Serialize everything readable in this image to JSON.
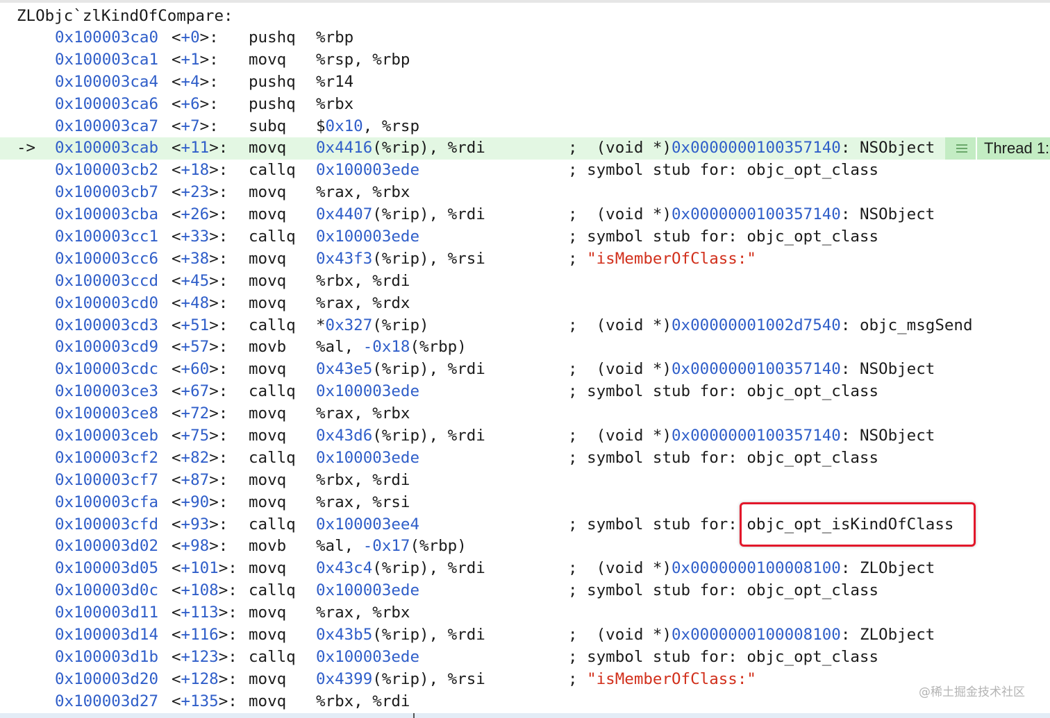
{
  "function_header": "ZLObjc`zlKindOfCompare:",
  "colors": {
    "address": "#2f5ec9",
    "string": "#d12f1b",
    "current_line_bg": "#e3f7e3",
    "thread_badge_bg": "#c3ecc3",
    "highlight_border": "#e2172a"
  },
  "current_line_indicator": "->",
  "thread_badge": {
    "icon": "lines-icon",
    "label": "Thread 1:"
  },
  "highlighted_text": "objc_opt_isKindOfClass",
  "watermark": "@稀土掘金技术社区",
  "instructions": [
    {
      "addr": "0x100003ca0",
      "off_pre": "<",
      "off": "+0",
      "off_post": ">:",
      "mnemonic": "pushq",
      "ops": [
        {
          "t": "%rbp",
          "c": ""
        }
      ],
      "comment": []
    },
    {
      "addr": "0x100003ca1",
      "off_pre": "<",
      "off": "+1",
      "off_post": ">:",
      "mnemonic": "movq",
      "ops": [
        {
          "t": "%rsp, %rbp",
          "c": ""
        }
      ],
      "comment": []
    },
    {
      "addr": "0x100003ca4",
      "off_pre": "<",
      "off": "+4",
      "off_post": ">:",
      "mnemonic": "pushq",
      "ops": [
        {
          "t": "%r14",
          "c": ""
        }
      ],
      "comment": []
    },
    {
      "addr": "0x100003ca6",
      "off_pre": "<",
      "off": "+6",
      "off_post": ">:",
      "mnemonic": "pushq",
      "ops": [
        {
          "t": "%rbx",
          "c": ""
        }
      ],
      "comment": []
    },
    {
      "addr": "0x100003ca7",
      "off_pre": "<",
      "off": "+7",
      "off_post": ">:",
      "mnemonic": "subq",
      "ops": [
        {
          "t": "$",
          "c": ""
        },
        {
          "t": "0x10",
          "c": "blue"
        },
        {
          "t": ", %rsp",
          "c": ""
        }
      ],
      "comment": []
    },
    {
      "current": true,
      "addr": "0x100003cab",
      "off_pre": "<",
      "off": "+11",
      "off_post": ">:",
      "mnemonic": "movq",
      "ops": [
        {
          "t": "0x4416",
          "c": "blue"
        },
        {
          "t": "(%rip), %rdi",
          "c": ""
        }
      ],
      "comment": [
        {
          "t": ";  (void *)",
          "c": ""
        },
        {
          "t": "0x0000000100357140",
          "c": "blue"
        },
        {
          "t": ": NSObject",
          "c": ""
        }
      ]
    },
    {
      "addr": "0x100003cb2",
      "off_pre": "<",
      "off": "+18",
      "off_post": ">:",
      "mnemonic": "callq",
      "ops": [
        {
          "t": "0x100003ede",
          "c": "blue"
        }
      ],
      "comment": [
        {
          "t": "; symbol stub for: objc_opt_class",
          "c": ""
        }
      ]
    },
    {
      "addr": "0x100003cb7",
      "off_pre": "<",
      "off": "+23",
      "off_post": ">:",
      "mnemonic": "movq",
      "ops": [
        {
          "t": "%rax, %rbx",
          "c": ""
        }
      ],
      "comment": []
    },
    {
      "addr": "0x100003cba",
      "off_pre": "<",
      "off": "+26",
      "off_post": ">:",
      "mnemonic": "movq",
      "ops": [
        {
          "t": "0x4407",
          "c": "blue"
        },
        {
          "t": "(%rip), %rdi",
          "c": ""
        }
      ],
      "comment": [
        {
          "t": ";  (void *)",
          "c": ""
        },
        {
          "t": "0x0000000100357140",
          "c": "blue"
        },
        {
          "t": ": NSObject",
          "c": ""
        }
      ]
    },
    {
      "addr": "0x100003cc1",
      "off_pre": "<",
      "off": "+33",
      "off_post": ">:",
      "mnemonic": "callq",
      "ops": [
        {
          "t": "0x100003ede",
          "c": "blue"
        }
      ],
      "comment": [
        {
          "t": "; symbol stub for: objc_opt_class",
          "c": ""
        }
      ]
    },
    {
      "addr": "0x100003cc6",
      "off_pre": "<",
      "off": "+38",
      "off_post": ">:",
      "mnemonic": "movq",
      "ops": [
        {
          "t": "0x43f3",
          "c": "blue"
        },
        {
          "t": "(%rip), %rsi",
          "c": ""
        }
      ],
      "comment": [
        {
          "t": "; ",
          "c": ""
        },
        {
          "t": "\"isMemberOfClass:\"",
          "c": "str"
        }
      ]
    },
    {
      "addr": "0x100003ccd",
      "off_pre": "<",
      "off": "+45",
      "off_post": ">:",
      "mnemonic": "movq",
      "ops": [
        {
          "t": "%rbx, %rdi",
          "c": ""
        }
      ],
      "comment": []
    },
    {
      "addr": "0x100003cd0",
      "off_pre": "<",
      "off": "+48",
      "off_post": ">:",
      "mnemonic": "movq",
      "ops": [
        {
          "t": "%rax, %rdx",
          "c": ""
        }
      ],
      "comment": []
    },
    {
      "addr": "0x100003cd3",
      "off_pre": "<",
      "off": "+51",
      "off_post": ">:",
      "mnemonic": "callq",
      "ops": [
        {
          "t": "*",
          "c": ""
        },
        {
          "t": "0x327",
          "c": "blue"
        },
        {
          "t": "(%rip)",
          "c": ""
        }
      ],
      "comment": [
        {
          "t": ";  (void *)",
          "c": ""
        },
        {
          "t": "0x00000001002d7540",
          "c": "blue"
        },
        {
          "t": ": objc_msgSend",
          "c": ""
        }
      ]
    },
    {
      "addr": "0x100003cd9",
      "off_pre": "<",
      "off": "+57",
      "off_post": ">:",
      "mnemonic": "movb",
      "ops": [
        {
          "t": "%al, ",
          "c": ""
        },
        {
          "t": "-0x18",
          "c": "blue"
        },
        {
          "t": "(%rbp)",
          "c": ""
        }
      ],
      "comment": []
    },
    {
      "addr": "0x100003cdc",
      "off_pre": "<",
      "off": "+60",
      "off_post": ">:",
      "mnemonic": "movq",
      "ops": [
        {
          "t": "0x43e5",
          "c": "blue"
        },
        {
          "t": "(%rip), %rdi",
          "c": ""
        }
      ],
      "comment": [
        {
          "t": ";  (void *)",
          "c": ""
        },
        {
          "t": "0x0000000100357140",
          "c": "blue"
        },
        {
          "t": ": NSObject",
          "c": ""
        }
      ]
    },
    {
      "addr": "0x100003ce3",
      "off_pre": "<",
      "off": "+67",
      "off_post": ">:",
      "mnemonic": "callq",
      "ops": [
        {
          "t": "0x100003ede",
          "c": "blue"
        }
      ],
      "comment": [
        {
          "t": "; symbol stub for: objc_opt_class",
          "c": ""
        }
      ]
    },
    {
      "addr": "0x100003ce8",
      "off_pre": "<",
      "off": "+72",
      "off_post": ">:",
      "mnemonic": "movq",
      "ops": [
        {
          "t": "%rax, %rbx",
          "c": ""
        }
      ],
      "comment": []
    },
    {
      "addr": "0x100003ceb",
      "off_pre": "<",
      "off": "+75",
      "off_post": ">:",
      "mnemonic": "movq",
      "ops": [
        {
          "t": "0x43d6",
          "c": "blue"
        },
        {
          "t": "(%rip), %rdi",
          "c": ""
        }
      ],
      "comment": [
        {
          "t": ";  (void *)",
          "c": ""
        },
        {
          "t": "0x0000000100357140",
          "c": "blue"
        },
        {
          "t": ": NSObject",
          "c": ""
        }
      ]
    },
    {
      "addr": "0x100003cf2",
      "off_pre": "<",
      "off": "+82",
      "off_post": ">:",
      "mnemonic": "callq",
      "ops": [
        {
          "t": "0x100003ede",
          "c": "blue"
        }
      ],
      "comment": [
        {
          "t": "; symbol stub for: objc_opt_class",
          "c": ""
        }
      ]
    },
    {
      "addr": "0x100003cf7",
      "off_pre": "<",
      "off": "+87",
      "off_post": ">:",
      "mnemonic": "movq",
      "ops": [
        {
          "t": "%rbx, %rdi",
          "c": ""
        }
      ],
      "comment": []
    },
    {
      "addr": "0x100003cfa",
      "off_pre": "<",
      "off": "+90",
      "off_post": ">:",
      "mnemonic": "movq",
      "ops": [
        {
          "t": "%rax, %rsi",
          "c": ""
        }
      ],
      "comment": []
    },
    {
      "addr": "0x100003cfd",
      "off_pre": "<",
      "off": "+93",
      "off_post": ">:",
      "mnemonic": "callq",
      "ops": [
        {
          "t": "0x100003ee4",
          "c": "blue"
        }
      ],
      "comment": [
        {
          "t": "; symbol stub for: ",
          "c": ""
        },
        {
          "t": "objc_opt_isKindOfClass",
          "c": ""
        }
      ]
    },
    {
      "addr": "0x100003d02",
      "off_pre": "<",
      "off": "+98",
      "off_post": ">:",
      "mnemonic": "movb",
      "ops": [
        {
          "t": "%al, ",
          "c": ""
        },
        {
          "t": "-0x17",
          "c": "blue"
        },
        {
          "t": "(%rbp)",
          "c": ""
        }
      ],
      "comment": []
    },
    {
      "addr": "0x100003d05",
      "off_pre": "<",
      "off": "+101",
      "off_post": ">:",
      "mnemonic": "movq",
      "ops": [
        {
          "t": "0x43c4",
          "c": "blue"
        },
        {
          "t": "(%rip), %rdi",
          "c": ""
        }
      ],
      "comment": [
        {
          "t": ";  (void *)",
          "c": ""
        },
        {
          "t": "0x0000000100008100",
          "c": "blue"
        },
        {
          "t": ": ZLObject",
          "c": ""
        }
      ]
    },
    {
      "addr": "0x100003d0c",
      "off_pre": "<",
      "off": "+108",
      "off_post": ">:",
      "mnemonic": "callq",
      "ops": [
        {
          "t": "0x100003ede",
          "c": "blue"
        }
      ],
      "comment": [
        {
          "t": "; symbol stub for: objc_opt_class",
          "c": ""
        }
      ]
    },
    {
      "addr": "0x100003d11",
      "off_pre": "<",
      "off": "+113",
      "off_post": ">:",
      "mnemonic": "movq",
      "ops": [
        {
          "t": "%rax, %rbx",
          "c": ""
        }
      ],
      "comment": []
    },
    {
      "addr": "0x100003d14",
      "off_pre": "<",
      "off": "+116",
      "off_post": ">:",
      "mnemonic": "movq",
      "ops": [
        {
          "t": "0x43b5",
          "c": "blue"
        },
        {
          "t": "(%rip), %rdi",
          "c": ""
        }
      ],
      "comment": [
        {
          "t": ";  (void *)",
          "c": ""
        },
        {
          "t": "0x0000000100008100",
          "c": "blue"
        },
        {
          "t": ": ZLObject",
          "c": ""
        }
      ]
    },
    {
      "addr": "0x100003d1b",
      "off_pre": "<",
      "off": "+123",
      "off_post": ">:",
      "mnemonic": "callq",
      "ops": [
        {
          "t": "0x100003ede",
          "c": "blue"
        }
      ],
      "comment": [
        {
          "t": "; symbol stub for: objc_opt_class",
          "c": ""
        }
      ]
    },
    {
      "addr": "0x100003d20",
      "off_pre": "<",
      "off": "+128",
      "off_post": ">:",
      "mnemonic": "movq",
      "ops": [
        {
          "t": "0x4399",
          "c": "blue"
        },
        {
          "t": "(%rip), %rsi",
          "c": ""
        }
      ],
      "comment": [
        {
          "t": "; ",
          "c": ""
        },
        {
          "t": "\"isMemberOfClass:\"",
          "c": "str"
        }
      ]
    },
    {
      "addr": "0x100003d27",
      "off_pre": "<",
      "off": "+135",
      "off_post": ">:",
      "mnemonic": "movq",
      "ops": [
        {
          "t": "%rbx, %rdi",
          "c": ""
        }
      ],
      "comment": []
    }
  ]
}
